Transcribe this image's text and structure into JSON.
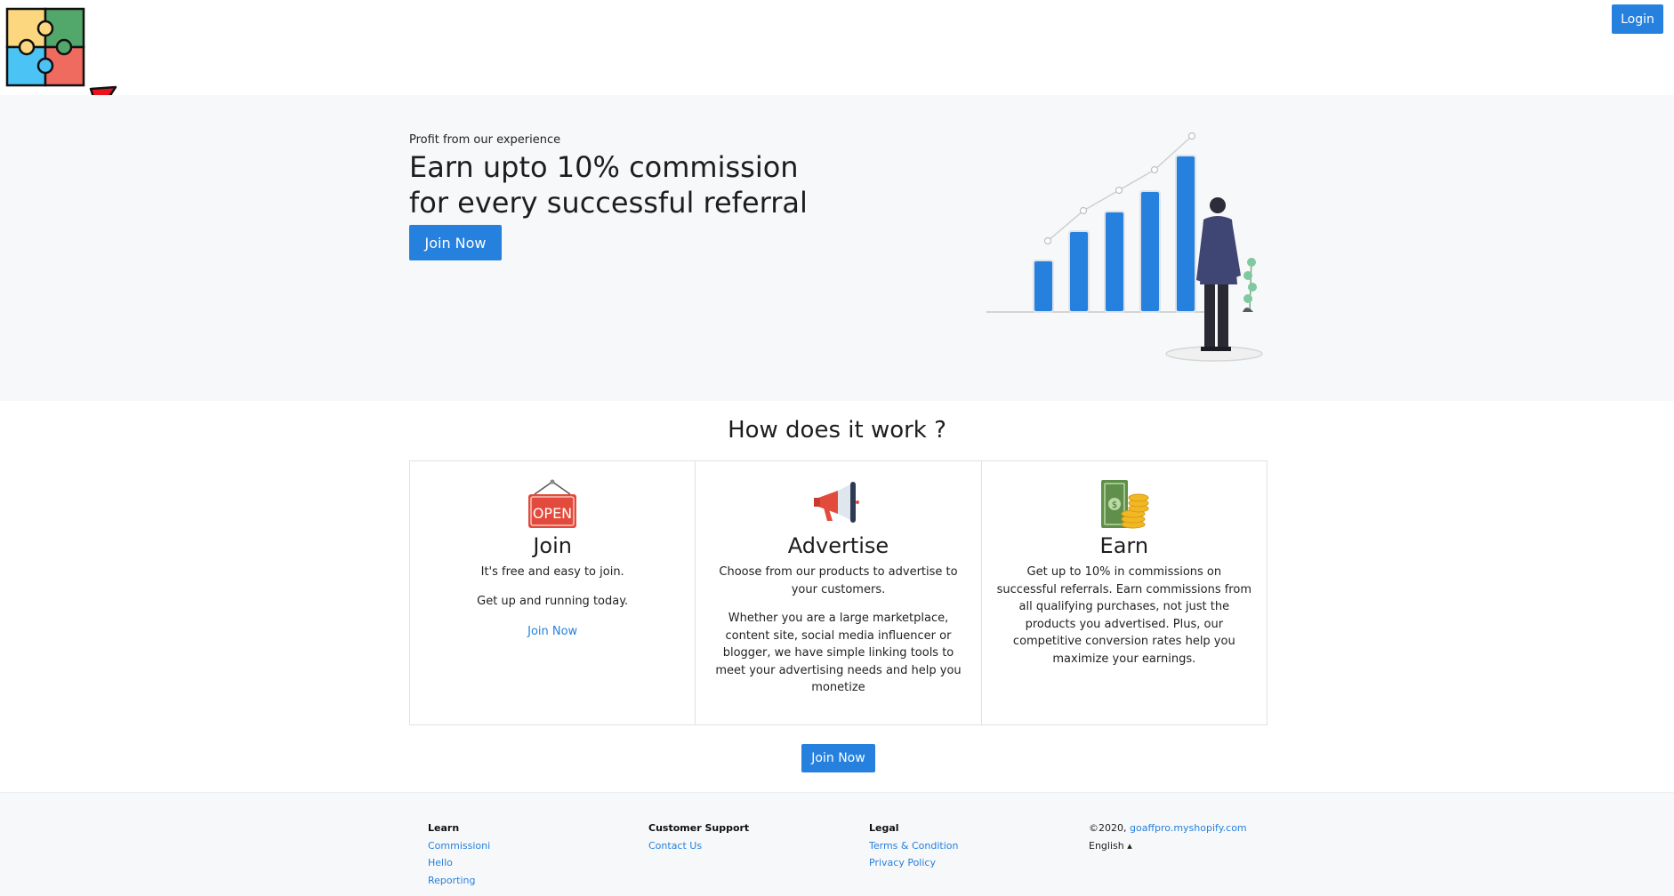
{
  "header": {
    "login_label": "Login"
  },
  "hero": {
    "eyebrow": "Profit from our experience",
    "title_line1": "Earn upto 10% commission",
    "title_line2": "for every successful referral",
    "join_label": "Join Now"
  },
  "how": {
    "title": "How does it work ?",
    "steps": [
      {
        "icon": "open-sign-icon",
        "title": "Join",
        "paragraphs": [
          "It's free and easy to join.",
          "Get up and running today."
        ],
        "link": "Join Now"
      },
      {
        "icon": "megaphone-icon",
        "title": "Advertise",
        "paragraphs": [
          "Choose from our products to advertise to your customers.",
          "Whether you are a large marketplace, content site, social media influencer or blogger, we have simple linking tools to meet your advertising needs and help you monetize"
        ]
      },
      {
        "icon": "money-coins-icon",
        "title": "Earn",
        "paragraphs": [
          "Get up to 10% in commissions on successful referrals. Earn commissions from all qualifying purchases, not just the products you advertised. Plus, our competitive conversion rates help you maximize your earnings."
        ]
      }
    ],
    "join_label": "Join Now"
  },
  "footer": {
    "learn": {
      "heading": "Learn",
      "links": [
        "Commissioni",
        "Hello",
        "Reporting"
      ]
    },
    "support": {
      "heading": "Customer Support",
      "links": [
        "Contact Us"
      ]
    },
    "legal": {
      "heading": "Legal",
      "links": [
        "Terms & Condition",
        "Privacy Policy"
      ]
    },
    "copyright_prefix": "©2020,",
    "domain": "goaffpro.myshopify.com",
    "language": "English"
  },
  "colors": {
    "accent": "#2680de",
    "hero_bg": "#f7f8f9"
  }
}
